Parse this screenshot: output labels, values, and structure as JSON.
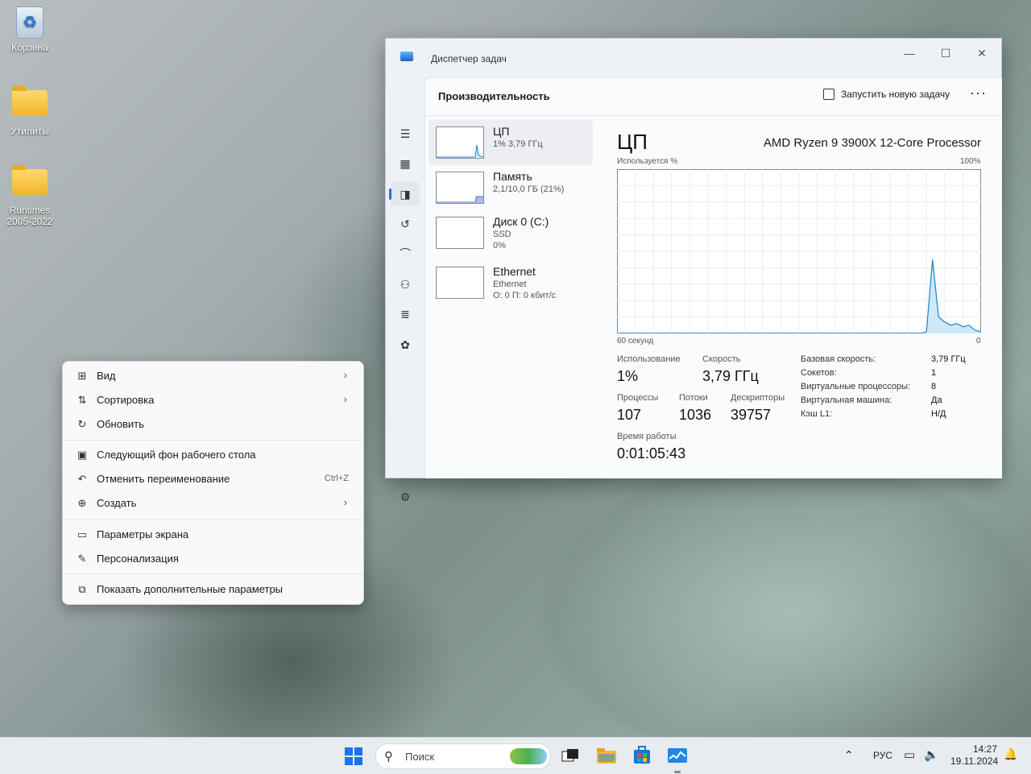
{
  "desktop": {
    "icons": [
      {
        "label": "Корзина",
        "icon": "recycle-bin-icon"
      },
      {
        "label": "Утилиты",
        "icon": "folder-icon"
      },
      {
        "label": "Runtimes 2005-2022",
        "icon": "folder-icon"
      }
    ]
  },
  "task_manager": {
    "title": "Диспетчер задач",
    "heading": "Производительность",
    "new_task_label": "Запустить новую задачу",
    "more_label": "···",
    "window_buttons": {
      "minimize": "—",
      "maximize": "☐",
      "close": "✕"
    },
    "perf_items": [
      {
        "name": "ЦП",
        "sub1": "1% 3,79 ГГц",
        "sub2": ""
      },
      {
        "name": "Память",
        "sub1": "2,1/10,0 ГБ (21%)",
        "sub2": ""
      },
      {
        "name": "Диск 0 (C:)",
        "sub1": "SSD",
        "sub2": "0%"
      },
      {
        "name": "Ethernet",
        "sub1": "Ethernet",
        "sub2": "О: 0 П: 0 кбит/с"
      }
    ],
    "detail": {
      "title": "ЦП",
      "processor": "AMD Ryzen 9 3900X 12-Core Processor",
      "graph_top_left": "Используется %",
      "graph_top_right": "100%",
      "graph_bottom_left": "60 секунд",
      "graph_bottom_right": "0",
      "usage_label": "Использование",
      "usage_value": "1%",
      "speed_label": "Скорость",
      "speed_value": "3,79 ГГц",
      "processes_label": "Процессы",
      "processes_value": "107",
      "threads_label": "Потоки",
      "threads_value": "1036",
      "handles_label": "Дескрипторы",
      "handles_value": "39757",
      "uptime_label": "Время работы",
      "uptime_value": "0:01:05:43",
      "specs": [
        {
          "k": "Базовая скорость:",
          "v": "3,79 ГГц"
        },
        {
          "k": "Сокетов:",
          "v": "1"
        },
        {
          "k": "Виртуальные процессоры:",
          "v": "8"
        },
        {
          "k": "Виртуальная машина:",
          "v": "Да"
        },
        {
          "k": "Кэш L1:",
          "v": "Н/Д"
        }
      ]
    },
    "cpu_history_percent": [
      0,
      0,
      0,
      0,
      0,
      0,
      0,
      0,
      0,
      0,
      0,
      0,
      0,
      0,
      0,
      0,
      0,
      0,
      0,
      0,
      0,
      0,
      0,
      0,
      0,
      0,
      0,
      0,
      0,
      0,
      0,
      0,
      0,
      0,
      0,
      0,
      0,
      0,
      0,
      0,
      0,
      0,
      0,
      0,
      0,
      0,
      0,
      0,
      0,
      0,
      0,
      1,
      45,
      10,
      7,
      5,
      6,
      4,
      5,
      2,
      1
    ]
  },
  "context_menu": {
    "items": [
      {
        "label": "Вид",
        "icon": "grid-icon",
        "submenu": true,
        "shortcut": ""
      },
      {
        "label": "Сортировка",
        "icon": "sort-icon",
        "submenu": true,
        "shortcut": ""
      },
      {
        "label": "Обновить",
        "icon": "refresh-icon",
        "submenu": false,
        "shortcut": ""
      },
      {
        "label": "Следующий фон рабочего стола",
        "icon": "next-background-icon",
        "submenu": false,
        "shortcut": ""
      },
      {
        "label": "Отменить переименование",
        "icon": "undo-icon",
        "submenu": false,
        "shortcut": "Ctrl+Z"
      },
      {
        "label": "Создать",
        "icon": "plus-circle-icon",
        "submenu": true,
        "shortcut": ""
      },
      {
        "label": "Параметры экрана",
        "icon": "display-settings-icon",
        "submenu": false,
        "shortcut": ""
      },
      {
        "label": "Персонализация",
        "icon": "brush-icon",
        "submenu": false,
        "shortcut": ""
      },
      {
        "label": "Показать дополнительные параметры",
        "icon": "open-external-icon",
        "submenu": false,
        "shortcut": ""
      }
    ]
  },
  "taskbar": {
    "search_placeholder": "Поиск",
    "language": "РУС",
    "time": "14:27",
    "date": "19.11.2024"
  },
  "colors": {
    "accent": "#2b6bd6",
    "graph_line": "#1a86c7",
    "graph_fill": "#cfe8f7"
  }
}
